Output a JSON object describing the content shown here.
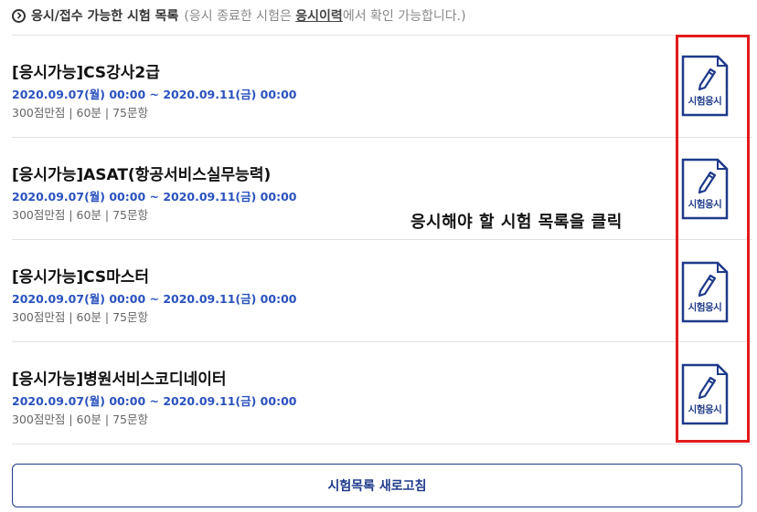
{
  "header": {
    "title": "응시/접수 가능한 시험 목록",
    "note_prefix": "(응시 종료한 시험은 ",
    "note_link": "응시이력",
    "note_suffix": "에서 확인 가능합니다.)"
  },
  "exams": [
    {
      "name": "[응시가능]CS강사2급",
      "period": "2020.09.07(월) 00:00 ~ 2020.09.11(금) 00:00",
      "meta": "300점만점 | 60분 | 75문항",
      "apply_label": "시험응시"
    },
    {
      "name": "[응시가능]ASAT(항공서비스실무능력)",
      "period": "2020.09.07(월) 00:00 ~ 2020.09.11(금) 00:00",
      "meta": "300점만점 | 60분 | 75문항",
      "apply_label": "시험응시"
    },
    {
      "name": "[응시가능]CS마스터",
      "period": "2020.09.07(월) 00:00 ~ 2020.09.11(금) 00:00",
      "meta": "300점만점 | 60분 | 75문항",
      "apply_label": "시험응시"
    },
    {
      "name": "[응시가능]병원서비스코디네이터",
      "period": "2020.09.07(월) 00:00 ~ 2020.09.11(금) 00:00",
      "meta": "300점만점 | 60분 | 75문항",
      "apply_label": "시험응시"
    }
  ],
  "annotation": "응시해야 할 시험 목록을 클릭",
  "refresh_label": "시험목록 새로고침",
  "colors": {
    "accent": "#1e3a8a",
    "period": "#2a52be",
    "highlight": "#e21b1b"
  }
}
